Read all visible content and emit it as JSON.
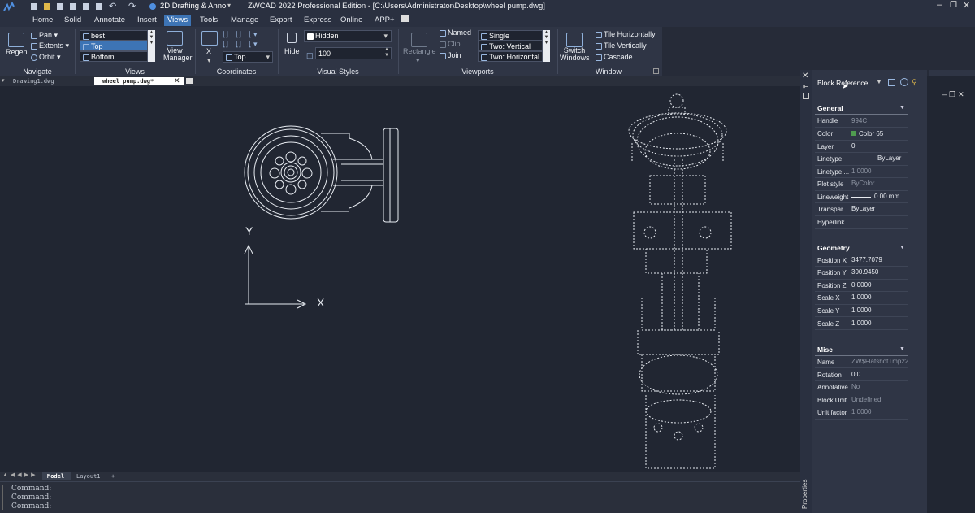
{
  "app": {
    "title": "ZWCAD 2022 Professional Edition - [C:\\Users\\Administrator\\Desktop\\wheel pump.dwg]",
    "workspace": "2D Drafting & Anno"
  },
  "menu": [
    "Home",
    "Solid",
    "Annotate",
    "Insert",
    "Views",
    "Tools",
    "Manage",
    "Export",
    "Express",
    "Online",
    "APP+"
  ],
  "ribbon": {
    "navigate": {
      "regen": "Regen",
      "pan": "Pan",
      "extents": "Extents",
      "orbit": "Orbit",
      "label": "Navigate"
    },
    "views": {
      "items": [
        "best",
        "Top",
        "Bottom"
      ],
      "manager": "View",
      "manager2": "Manager",
      "label": "Views"
    },
    "coordinates": {
      "ucs_x": "X",
      "top": "Top",
      "label": "Coordinates"
    },
    "visual": {
      "hide": "Hide",
      "style": "Hidden",
      "value": "100",
      "label": "Visual Styles"
    },
    "viewports": {
      "rectangle": "Rectangle",
      "named": "Named",
      "clip": "Clip",
      "join": "Join",
      "single": "Single",
      "two": "Two:",
      "vertical": "Vertical",
      "horizontal": "Horizontal",
      "label": "Viewports"
    },
    "window": {
      "switch": "Switch",
      "switch2": "Windows",
      "tile_h": "Tile Horizontally",
      "tile_v": "Tile Vertically",
      "cascade": "Cascade",
      "label": "Window"
    }
  },
  "doc_tabs": [
    "Drawing1.dwg",
    "wheel pump.dwg*"
  ],
  "layout_tabs": [
    "Model",
    "Layout1",
    "+"
  ],
  "axes": {
    "x": "X",
    "y": "Y"
  },
  "command_lines": [
    "Command:",
    "Command:",
    "Command:"
  ],
  "properties": {
    "title": "Properties",
    "selection": "Block Reference",
    "general_label": "General",
    "general": [
      [
        "Handle",
        "994C"
      ],
      [
        "Color",
        "Color 65"
      ],
      [
        "Layer",
        "0"
      ],
      [
        "Linetype",
        "ByLayer"
      ],
      [
        "Linetype ...",
        "1.0000"
      ],
      [
        "Plot style",
        "ByColor"
      ],
      [
        "Lineweight",
        "0.00 mm"
      ],
      [
        "Transpar...",
        "ByLayer"
      ],
      [
        "Hyperlink",
        ""
      ]
    ],
    "geometry_label": "Geometry",
    "geometry": [
      [
        "Position X",
        "3477.7079"
      ],
      [
        "Position Y",
        "300.9450"
      ],
      [
        "Position Z",
        "0.0000"
      ],
      [
        "Scale X",
        "1.0000"
      ],
      [
        "Scale Y",
        "1.0000"
      ],
      [
        "Scale Z",
        "1.0000"
      ]
    ],
    "misc_label": "Misc",
    "misc": [
      [
        "Name",
        "ZW$FlatshotTmp22"
      ],
      [
        "Rotation",
        "0.0"
      ],
      [
        "Annotative",
        "No"
      ],
      [
        "Block Unit",
        "Undefined"
      ],
      [
        "Unit factor",
        "1.0000"
      ]
    ]
  },
  "colors": {
    "accent": "#3d74b5",
    "canvas": "#212632",
    "color65": "#4f9b4f"
  }
}
